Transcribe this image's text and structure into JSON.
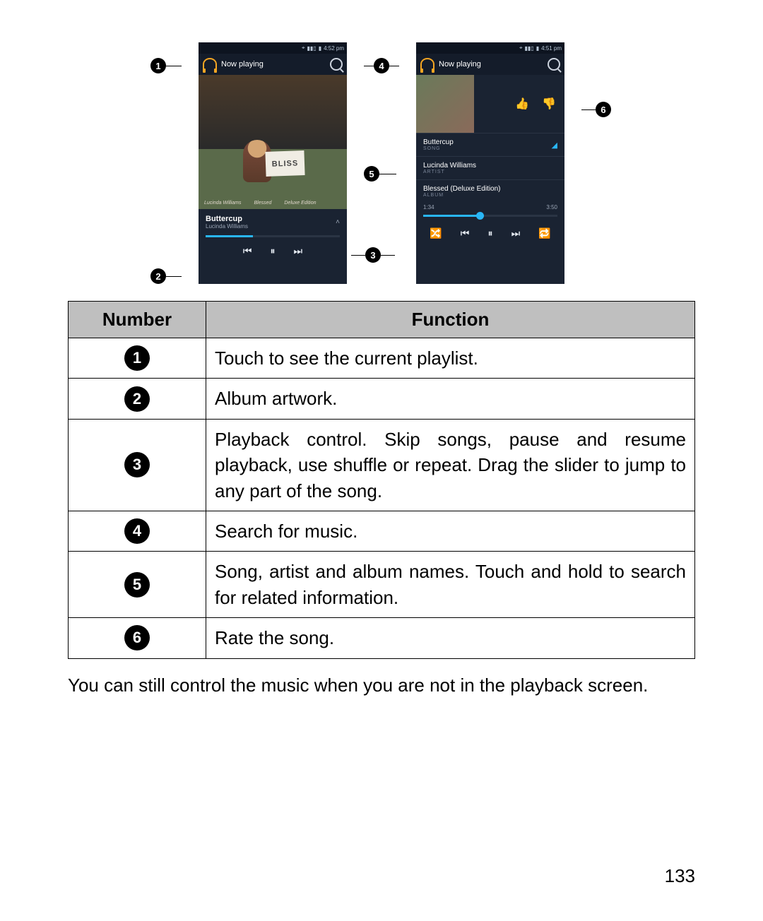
{
  "screenshot": {
    "status_time_left": "4:52 pm",
    "status_time_right": "4:51 pm",
    "appbar_title": "Now playing",
    "album_sign": "BLISS",
    "artwork_caption_artist": "Lucinda Williams",
    "artwork_caption_album": "Blessed",
    "artwork_caption_edition": "Deluxe Edition",
    "track_name": "Buttercup",
    "track_artist": "Lucinda Williams",
    "info_song": "Buttercup",
    "info_song_sub": "SONG",
    "info_artist": "Lucinda Williams",
    "info_artist_sub": "ARTIST",
    "info_album": "Blessed (Deluxe Edition)",
    "info_album_sub": "ALBUM",
    "time_current": "1:34",
    "time_total": "3:50",
    "progress_pct_left": 35,
    "progress_pct_right": 42
  },
  "callouts": [
    "1",
    "2",
    "3",
    "4",
    "5",
    "6"
  ],
  "table": {
    "head_number": "Number",
    "head_function": "Function",
    "rows": [
      {
        "n": "1",
        "f": "Touch to see the current playlist."
      },
      {
        "n": "2",
        "f": "Album artwork."
      },
      {
        "n": "3",
        "f": "Playback control. Skip songs, pause and resume playback, use shuffle or repeat. Drag the slider to jump to any part of the song."
      },
      {
        "n": "4",
        "f": "Search for music."
      },
      {
        "n": "5",
        "f": "Song, artist and album names. Touch and hold to search for related information."
      },
      {
        "n": "6",
        "f": "Rate the song."
      }
    ]
  },
  "footer_text": "You can still control the music when you are not in the playback screen.",
  "page_number": "133"
}
